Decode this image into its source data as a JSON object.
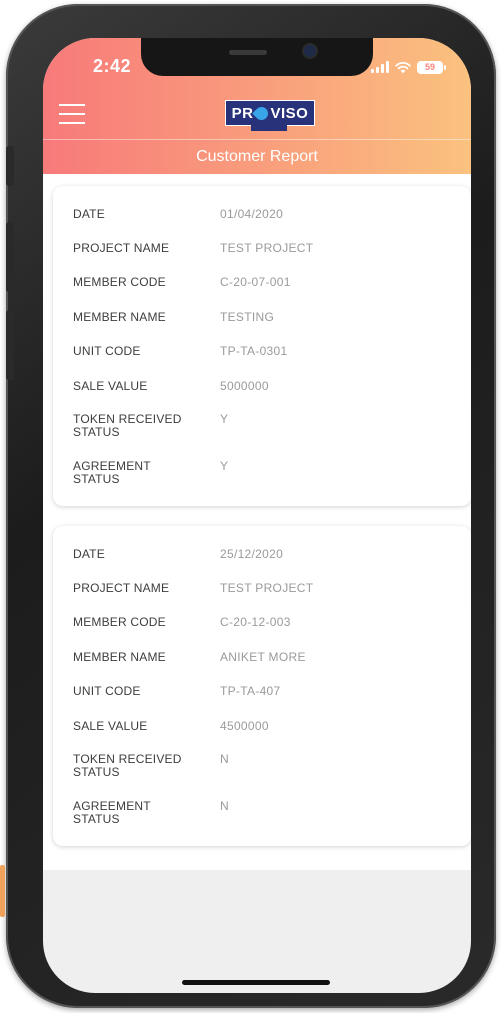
{
  "status_bar": {
    "time": "2:42",
    "battery": "59"
  },
  "app_bar": {
    "logo_text_left": "PR",
    "logo_text_right": "VISO"
  },
  "page_title": "Customer Report",
  "records": [
    {
      "fields": [
        {
          "label": "DATE",
          "value": "01/04/2020"
        },
        {
          "label": "PROJECT NAME",
          "value": "TEST PROJECT"
        },
        {
          "label": "MEMBER CODE",
          "value": "C-20-07-001"
        },
        {
          "label": "MEMBER NAME",
          "value": "TESTING"
        },
        {
          "label": "UNIT CODE",
          "value": "TP-TA-0301"
        },
        {
          "label": "SALE VALUE",
          "value": "5000000"
        },
        {
          "label": "TOKEN RECEIVED\nSTATUS",
          "value": "Y"
        },
        {
          "label": "AGREEMENT\nSTATUS",
          "value": "Y"
        }
      ]
    },
    {
      "fields": [
        {
          "label": "DATE",
          "value": "25/12/2020"
        },
        {
          "label": "PROJECT NAME",
          "value": "TEST PROJECT"
        },
        {
          "label": "MEMBER CODE",
          "value": "C-20-12-003"
        },
        {
          "label": "MEMBER NAME",
          "value": "ANIKET MORE"
        },
        {
          "label": "UNIT CODE",
          "value": "TP-TA-407"
        },
        {
          "label": "SALE VALUE",
          "value": "4500000"
        },
        {
          "label": "TOKEN RECEIVED\nSTATUS",
          "value": "N"
        },
        {
          "label": "AGREEMENT\nSTATUS",
          "value": "N"
        }
      ]
    }
  ],
  "colors": {
    "header_gradient_start": "#f77a7a",
    "header_gradient_end": "#fbc27f",
    "logo_bg": "#27327a",
    "label_text": "#3d3d3d",
    "value_text": "#9a9a9a"
  },
  "icons": {
    "menu": "hamburger-menu-icon",
    "signal": "cellular-signal-icon",
    "wifi": "wifi-icon",
    "battery": "battery-icon"
  }
}
